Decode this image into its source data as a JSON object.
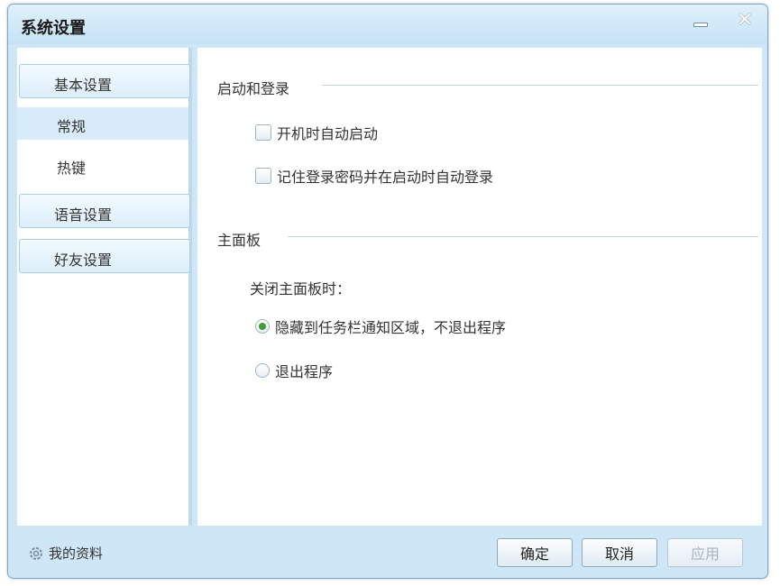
{
  "window": {
    "title": "系统设置",
    "minimize_label": "—",
    "close_label": "✕"
  },
  "sidebar": {
    "items": [
      {
        "label": "基本设置",
        "type": "group"
      },
      {
        "label": "常规",
        "type": "sub",
        "active": true
      },
      {
        "label": "热键",
        "type": "sub",
        "active": false
      },
      {
        "label": "语音设置",
        "type": "group"
      },
      {
        "label": "好友设置",
        "type": "group"
      }
    ]
  },
  "content": {
    "startup": {
      "title": "启动和登录",
      "options": [
        {
          "label": "开机时自动启动",
          "checked": false
        },
        {
          "label": "记住登录密码并在启动时自动登录",
          "checked": false
        }
      ]
    },
    "panel": {
      "title": "主面板",
      "close_label": "关闭主面板时：",
      "options": [
        {
          "label": "隐藏到任务栏通知区域，不退出程序",
          "selected": true
        },
        {
          "label": "退出程序",
          "selected": false
        }
      ]
    }
  },
  "footer": {
    "profile_label": "我的资料",
    "ok_label": "确定",
    "cancel_label": "取消",
    "apply_label": "应用"
  },
  "colors": {
    "frame": "#cfe6f7",
    "selected_item": "#d8ebf9",
    "radio_selected": "#3f9f2f"
  }
}
